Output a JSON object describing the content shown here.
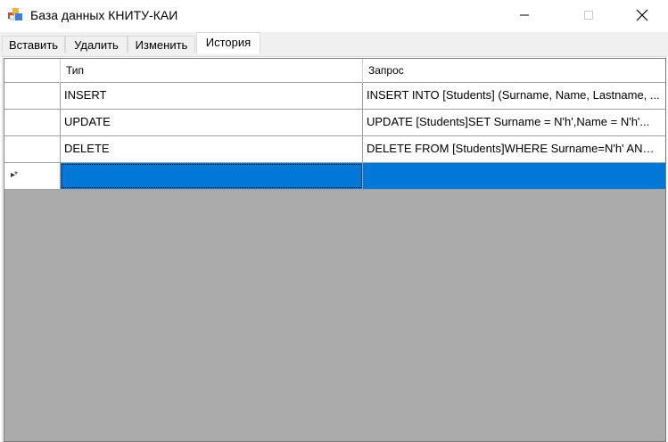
{
  "window": {
    "title": "База данных КНИТУ-КАИ",
    "icon": "database-app-icon"
  },
  "tabs": [
    {
      "label": "Вставить",
      "active": false
    },
    {
      "label": "Удалить",
      "active": false
    },
    {
      "label": "Изменить",
      "active": false
    },
    {
      "label": "История",
      "active": true
    }
  ],
  "grid": {
    "columns": [
      "Тип",
      "Запрос"
    ],
    "rows": [
      {
        "type": "INSERT",
        "query": "INSERT INTO [Students] (Surname, Name, Lastname, ..."
      },
      {
        "type": "UPDATE",
        "query": "UPDATE [Students]SET Surname = N'h',Name = N'h'..."
      },
      {
        "type": "DELETE",
        "query": "DELETE FROM [Students]WHERE Surname=N'h' AND ..."
      }
    ],
    "new_row_marker": "▸*",
    "colors": {
      "selection": "#0078d7",
      "background": "#ababab"
    }
  }
}
